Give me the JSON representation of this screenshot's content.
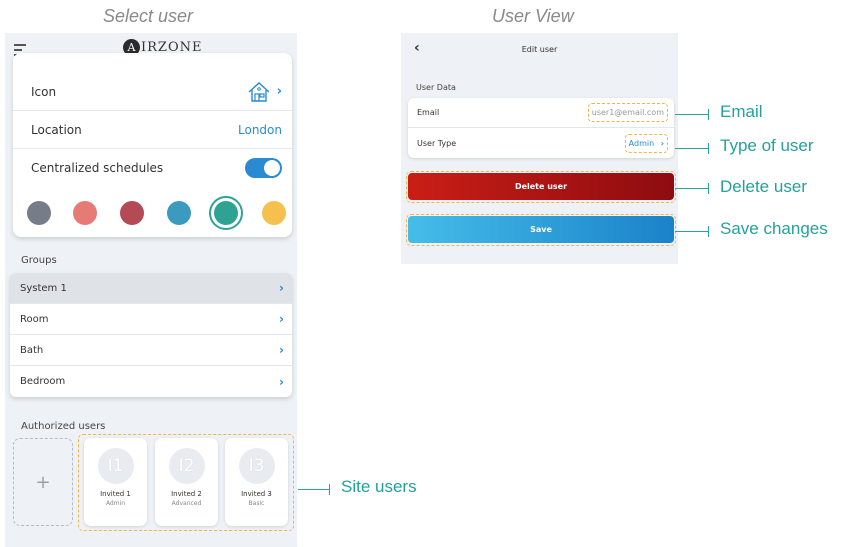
{
  "captions": {
    "left": "Select user",
    "right": "User View"
  },
  "left_screen": {
    "logo_text": "IRZONE",
    "logo_mark": "A",
    "icon_row": {
      "label": "Icon",
      "icon": "house-icon"
    },
    "location_row": {
      "label": "Location",
      "value": "London"
    },
    "schedules_row": {
      "label": "Centralized schedules",
      "toggle": "on"
    },
    "colors": [
      "#767d88",
      "#e57b74",
      "#b44a55",
      "#3a9bbf",
      "#2fa393",
      "#f6c04f"
    ],
    "selected_color_index": 4,
    "groups_label": "Groups",
    "groups": [
      {
        "label": "System 1"
      },
      {
        "label": "Room"
      },
      {
        "label": "Bath"
      },
      {
        "label": "Bedroom"
      }
    ],
    "authorized_label": "Authorized users",
    "add_label": "+",
    "users": [
      {
        "initials": "I1",
        "name": "Invited 1",
        "type": "Admin"
      },
      {
        "initials": "I2",
        "name": "Invited 2",
        "type": "Advanced"
      },
      {
        "initials": "I3",
        "name": "Invited 3",
        "type": "Basic"
      }
    ]
  },
  "right_screen": {
    "back_icon": "chevron-left-icon",
    "title": "Edit user",
    "section_label": "User Data",
    "email_label": "Email",
    "email_value": "user1@email.com",
    "user_type_label": "User Type",
    "user_type_value": "Admin",
    "delete_label": "Delete user",
    "save_label": "Save"
  },
  "annotations": {
    "email": "Email",
    "type_of_user": "Type of user",
    "delete_user": "Delete user",
    "save_changes": "Save changes",
    "site_users": "Site users"
  }
}
